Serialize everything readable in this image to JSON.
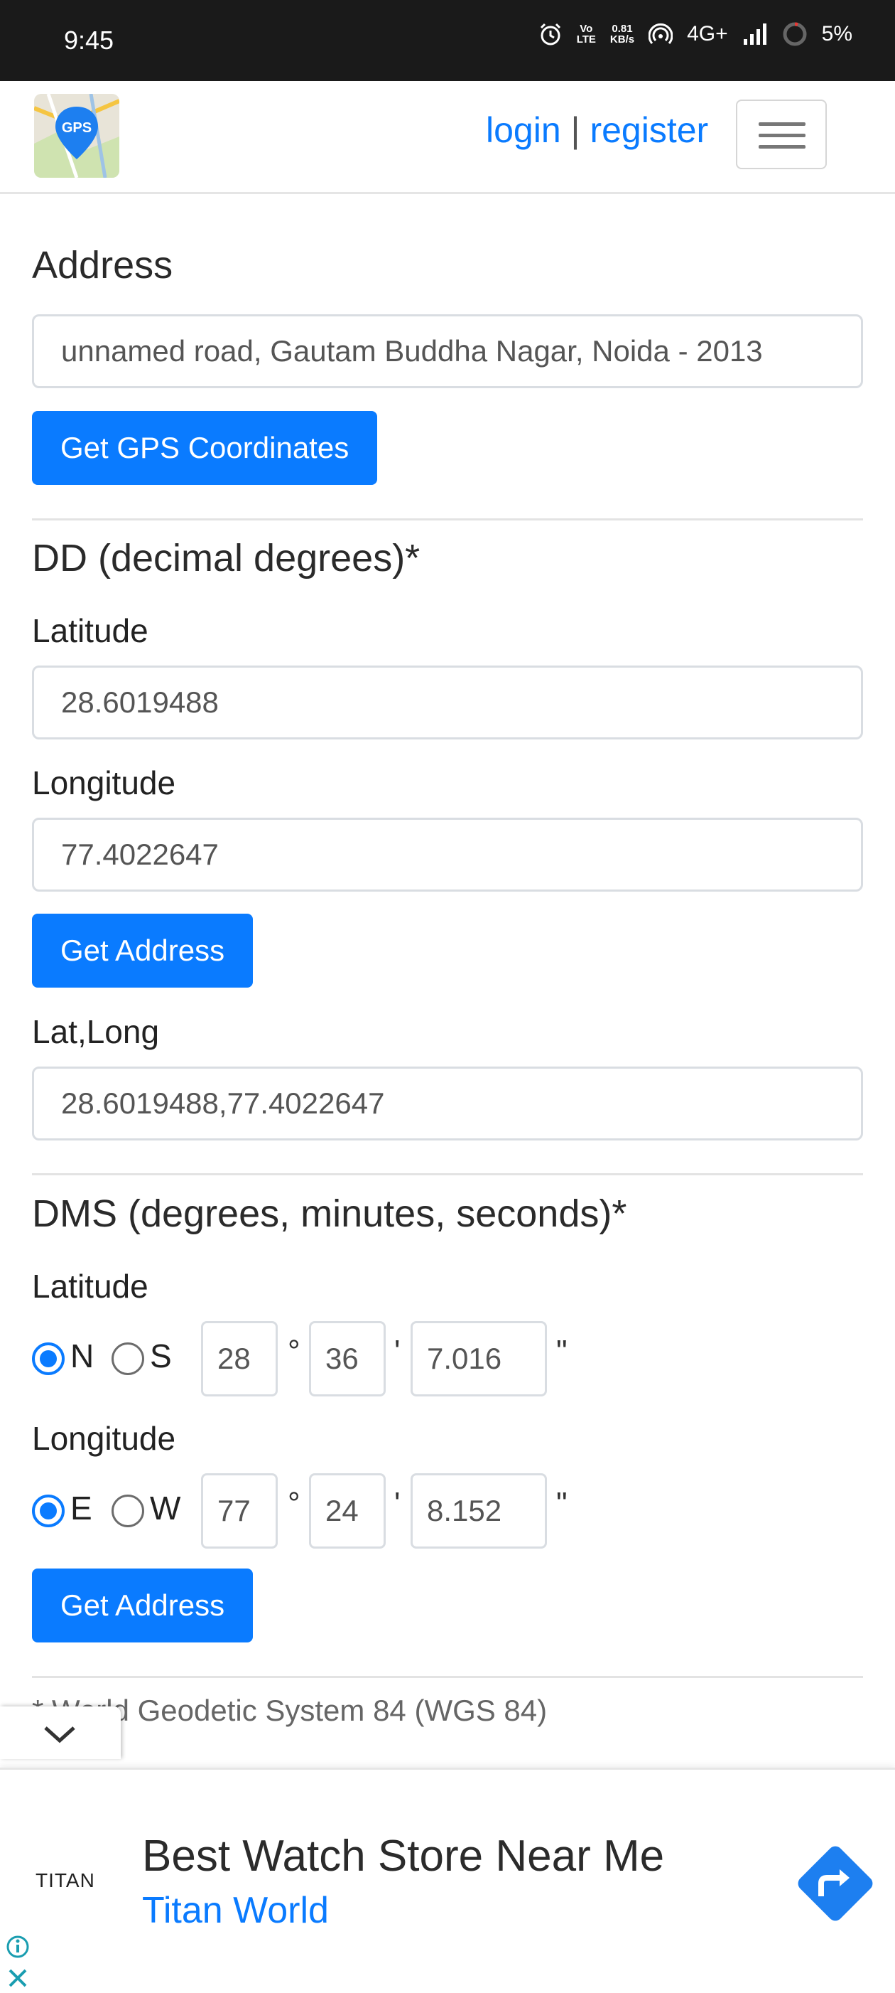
{
  "status_bar": {
    "time": "9:45",
    "network_speed_value": "0.81",
    "network_speed_unit": "KB/s",
    "volte_top": "Vo",
    "volte_bottom": "LTE",
    "network_type": "4G+",
    "battery": "5%"
  },
  "navbar": {
    "logo_text": "GPS",
    "login_label": "login",
    "separator": "|",
    "register_label": "register"
  },
  "address": {
    "title": "Address",
    "value": "unnamed road, Gautam Buddha Nagar, Noida - 2013",
    "button_label": "Get GPS Coordinates"
  },
  "dd": {
    "title": "DD (decimal degrees)*",
    "latitude_label": "Latitude",
    "latitude_value": "28.6019488",
    "longitude_label": "Longitude",
    "longitude_value": "77.4022647",
    "button_label": "Get Address",
    "latlong_label": "Lat,Long",
    "latlong_value": "28.6019488,77.4022647"
  },
  "dms": {
    "title": "DMS (degrees, minutes, seconds)*",
    "latitude_label": "Latitude",
    "lat_dir_1": "N",
    "lat_dir_2": "S",
    "lat_degrees": "28",
    "lat_minutes": "36",
    "lat_seconds": "7.016",
    "longitude_label": "Longitude",
    "lon_dir_1": "E",
    "lon_dir_2": "W",
    "lon_degrees": "77",
    "lon_minutes": "24",
    "lon_seconds": "8.152",
    "degree_symbol": "°",
    "minute_symbol": "'",
    "second_symbol": "\"",
    "button_label": "Get Address",
    "selected_lat": "N",
    "selected_lon": "E"
  },
  "footnote": "* World Geodetic System 84 (WGS 84)",
  "ad": {
    "brand": "TITAN",
    "title": "Best Watch Store Near Me",
    "subtitle": "Titan World",
    "accent_color": "#0a7bff"
  },
  "colors": {
    "primary": "#0a7bff",
    "status_bar_bg": "#1a1a1a"
  }
}
